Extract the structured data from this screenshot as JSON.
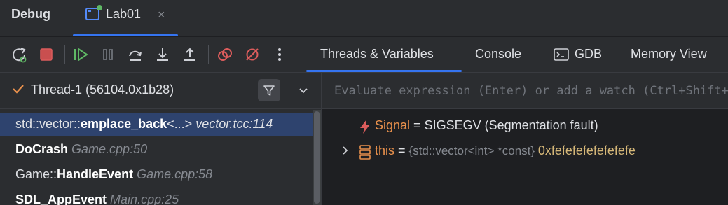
{
  "window": {
    "title": "Debug"
  },
  "tab": {
    "label": "Lab01",
    "close": "×"
  },
  "toolbar": {
    "buttons": [
      "rerun-icon",
      "stop-icon",
      "resume-icon",
      "pause-icon",
      "step-over-icon",
      "step-into-icon",
      "step-out-icon",
      "view-breakpoints-icon",
      "mute-breakpoints-icon",
      "more-icon"
    ],
    "tabs": [
      "Threads & Variables",
      "Console",
      "GDB",
      "Memory View"
    ]
  },
  "threads": {
    "selected": "Thread-1 (56104.0x1b28)"
  },
  "frames": [
    {
      "prefix": "std::vector::",
      "name": "emplace_back",
      "suffix": "<...>",
      "location": "vector.tcc:114"
    },
    {
      "prefix": "",
      "name": "DoCrash",
      "suffix": "",
      "location": "Game.cpp:50"
    },
    {
      "prefix": "Game::",
      "name": "HandleEvent",
      "suffix": "",
      "location": "Game.cpp:58"
    },
    {
      "prefix": "",
      "name": "SDL_AppEvent",
      "suffix": "",
      "location": "Main.cpp:25"
    }
  ],
  "evaluate": {
    "placeholder": "Evaluate expression (Enter) or add a watch (Ctrl+Shift+Enter)"
  },
  "variables": [
    {
      "name": "Signal",
      "eq": " = ",
      "value": "SIGSEGV (Segmentation fault)",
      "type": "",
      "icon": "lightning-icon"
    },
    {
      "name": "this",
      "eq": " = ",
      "value": "0xfefefefefefefefe",
      "type": "{std::vector<int> *const} ",
      "icon": "structure-icon"
    }
  ],
  "colors": {
    "accent": "#3574f0",
    "selection": "#2e436e",
    "error": "#db5c5c",
    "run": "#5fb865"
  }
}
